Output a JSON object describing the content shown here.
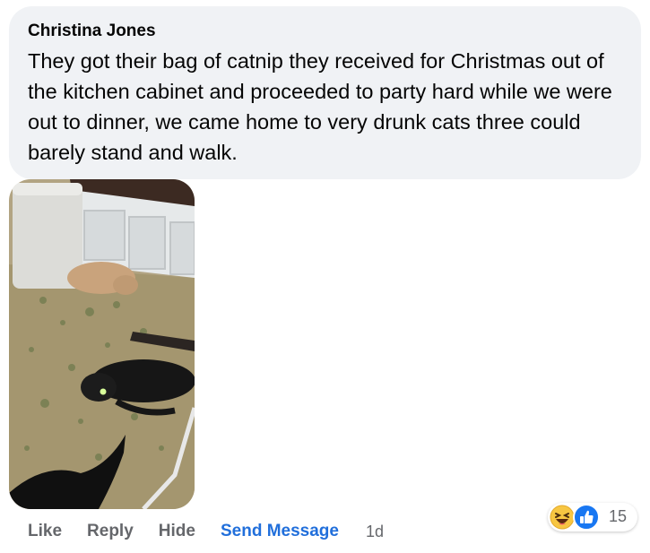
{
  "comment": {
    "author": "Christina Jones",
    "text": "They got their bag of catnip they received for Christmas out of the kitchen cabinet and proceeded to party hard while we were out to dinner, we came home to very drunk cats three could barely stand and walk."
  },
  "actions": {
    "like": "Like",
    "reply": "Reply",
    "hide": "Hide",
    "send_message": "Send Message",
    "time": "1d"
  },
  "reactions": {
    "icons": [
      "haha-icon",
      "like-icon"
    ],
    "count": "15"
  },
  "colors": {
    "bubble": "#f0f2f5",
    "link_blue": "#216fdb",
    "action_gray": "#65676b",
    "like_blue": "#1877f2",
    "haha_yellow": "#f7c642"
  }
}
